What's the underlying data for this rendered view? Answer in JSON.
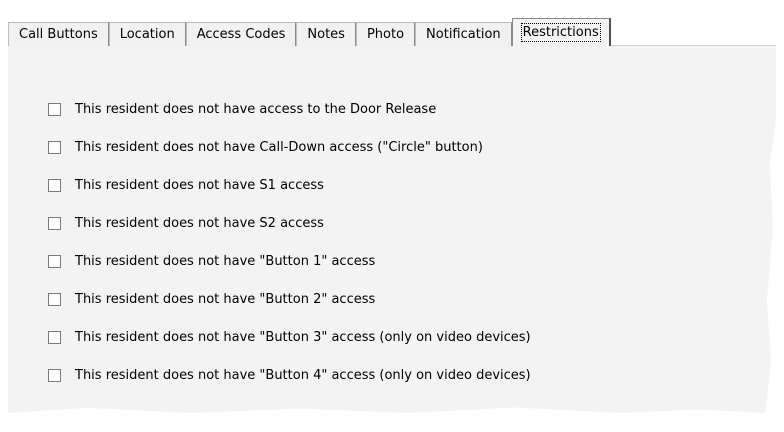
{
  "tabs": [
    {
      "label": "Call Buttons",
      "active": false
    },
    {
      "label": "Location",
      "active": false
    },
    {
      "label": "Access Codes",
      "active": false
    },
    {
      "label": "Notes",
      "active": false
    },
    {
      "label": "Photo",
      "active": false
    },
    {
      "label": "Notification",
      "active": false
    },
    {
      "label": "Restrictions",
      "active": true
    }
  ],
  "restrictions": [
    {
      "label": "This resident does not have access to the Door Release",
      "checked": false
    },
    {
      "label": "This resident does not have Call-Down access (\"Circle\" button)",
      "checked": false
    },
    {
      "label": "This resident does not have S1 access",
      "checked": false
    },
    {
      "label": "This resident does not have S2 access",
      "checked": false
    },
    {
      "label": "This resident does not have \"Button 1\" access",
      "checked": false
    },
    {
      "label": "This resident does not have \"Button 2\" access",
      "checked": false
    },
    {
      "label": "This resident does not have \"Button 3\" access (only on video devices)",
      "checked": false
    },
    {
      "label": "This resident does not have \"Button 4\" access (only on video devices)",
      "checked": false
    }
  ]
}
